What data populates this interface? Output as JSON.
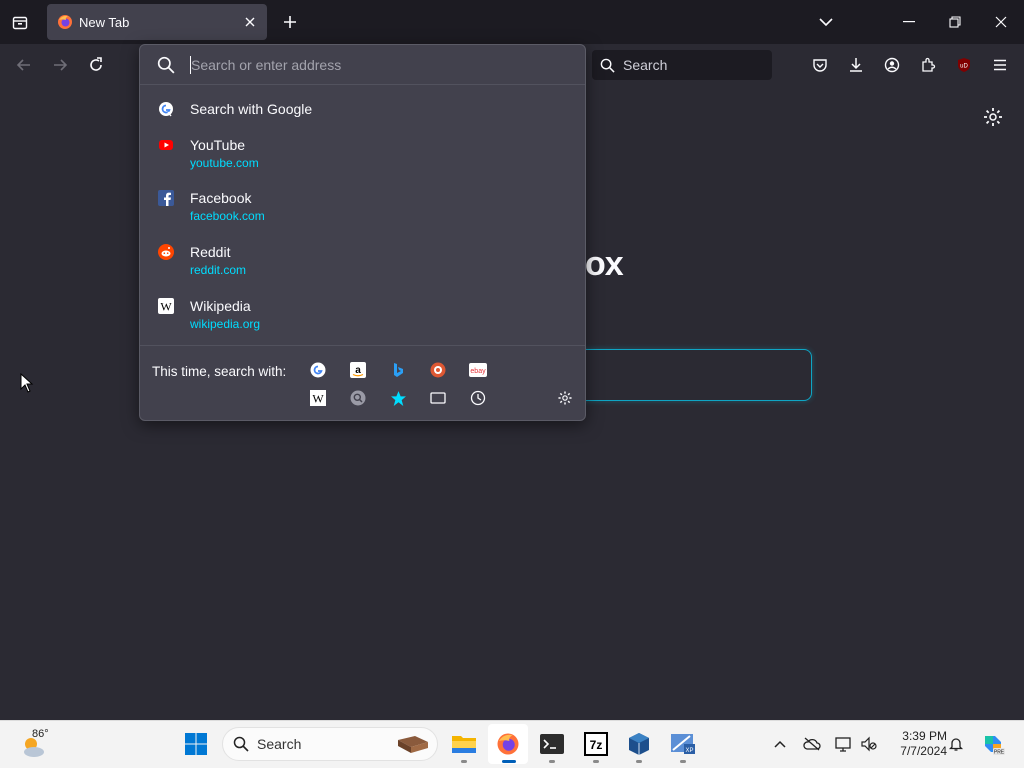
{
  "browser": {
    "tab": {
      "title": "New Tab",
      "icon": "firefox-icon"
    },
    "toolbar_icons": [
      "back-icon",
      "forward-icon",
      "reload-icon",
      "pocket-icon",
      "downloads-icon",
      "account-icon",
      "extensions-icon",
      "ublock-icon",
      "menu-icon"
    ],
    "search_bar": {
      "placeholder": "Search"
    }
  },
  "urlbar": {
    "placeholder": "Search or enter address",
    "results": [
      {
        "title": "Search with Google",
        "url": "",
        "icon": "google-icon"
      },
      {
        "title": "YouTube",
        "url": "youtube.com",
        "icon": "youtube-icon"
      },
      {
        "title": "Facebook",
        "url": "facebook.com",
        "icon": "facebook-icon"
      },
      {
        "title": "Reddit",
        "url": "reddit.com",
        "icon": "reddit-icon"
      },
      {
        "title": "Wikipedia",
        "url": "wikipedia.org",
        "icon": "wikipedia-icon"
      }
    ],
    "one_off_label": "This time, search with:",
    "one_off_engines": [
      "google-icon",
      "amazon-icon",
      "bing-icon",
      "duckduckgo-icon",
      "ebay-icon",
      "wikipedia-icon",
      "search-icon",
      "bookmarks-icon",
      "tabs-icon",
      "history-icon"
    ]
  },
  "newtab": {
    "brand_fragment": "ox"
  },
  "taskbar": {
    "weather_temp": "86°",
    "search_label": "Search",
    "time": "3:39 PM",
    "date": "7/7/2024",
    "apps": [
      "start-icon",
      "file-explorer-icon",
      "firefox-icon",
      "terminal-icon",
      "7zip-icon",
      "virtualbox-icon",
      "xp-mode-icon"
    ]
  }
}
